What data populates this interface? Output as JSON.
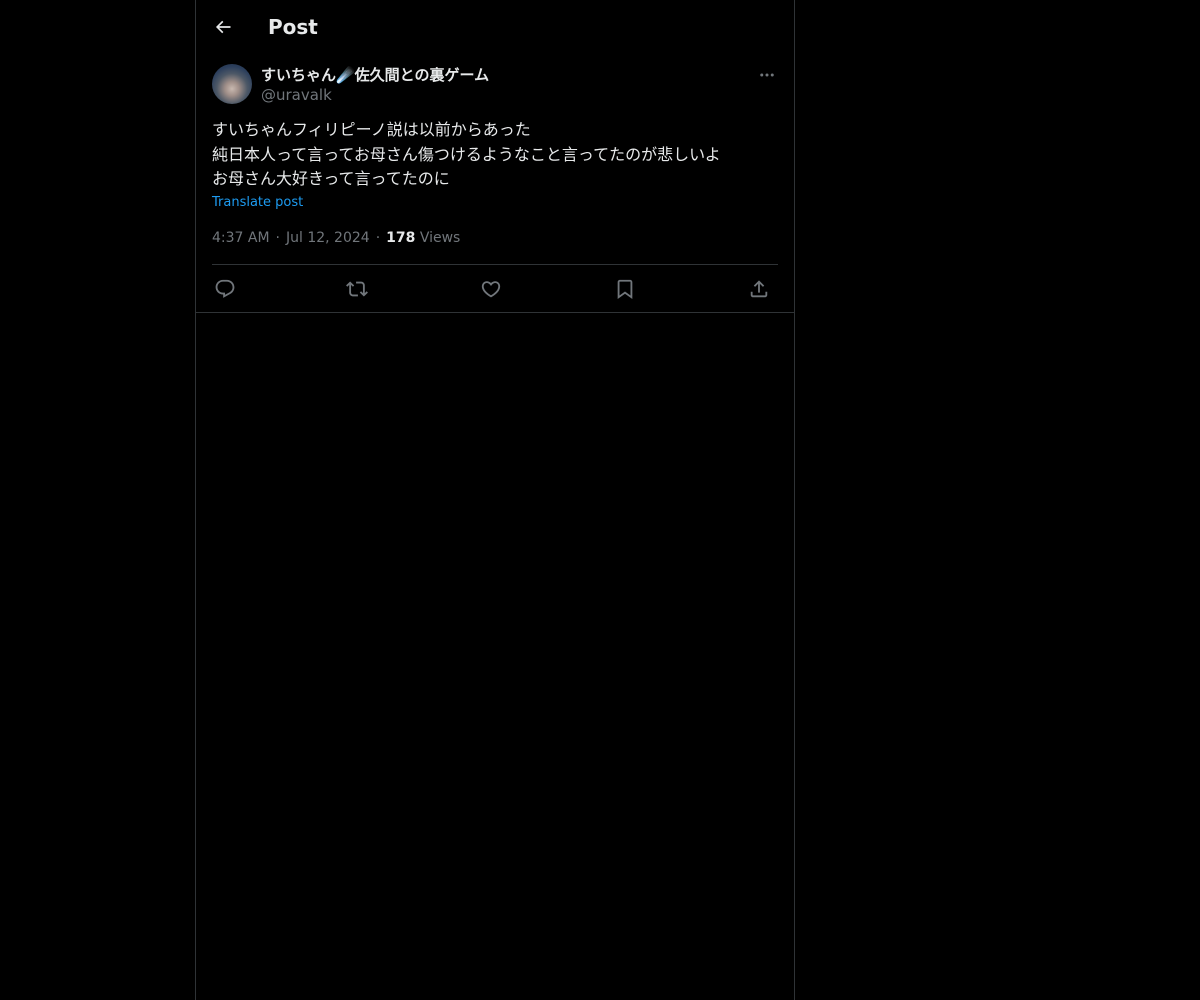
{
  "header": {
    "title": "Post",
    "back_icon": "arrow-left-icon"
  },
  "author": {
    "name": "すいちゃん☄️佐久間との裏ゲーム",
    "handle": "@uravalk",
    "more_icon": "more-horizontal-icon"
  },
  "post": {
    "lines": [
      "すいちゃんフィリピーノ説は以前からあった",
      "純日本人って言ってお母さん傷つけるようなこと言ってたのが悲しいよ",
      "お母さん大好きって言ってたのに"
    ],
    "translate_label": "Translate post"
  },
  "meta": {
    "time": "4:37 AM",
    "date": "Jul 12, 2024",
    "separator": "·",
    "views_count": "178",
    "views_label": "Views"
  },
  "actions": [
    {
      "name": "reply",
      "icon": "reply-icon"
    },
    {
      "name": "repost",
      "icon": "repost-icon"
    },
    {
      "name": "like",
      "icon": "heart-icon"
    },
    {
      "name": "bookmark",
      "icon": "bookmark-icon"
    },
    {
      "name": "share",
      "icon": "share-icon"
    }
  ],
  "colors": {
    "background": "#000000",
    "text_primary": "#e7e9ea",
    "text_secondary": "#71767b",
    "link": "#1d9bf0",
    "border": "#2f3336"
  }
}
